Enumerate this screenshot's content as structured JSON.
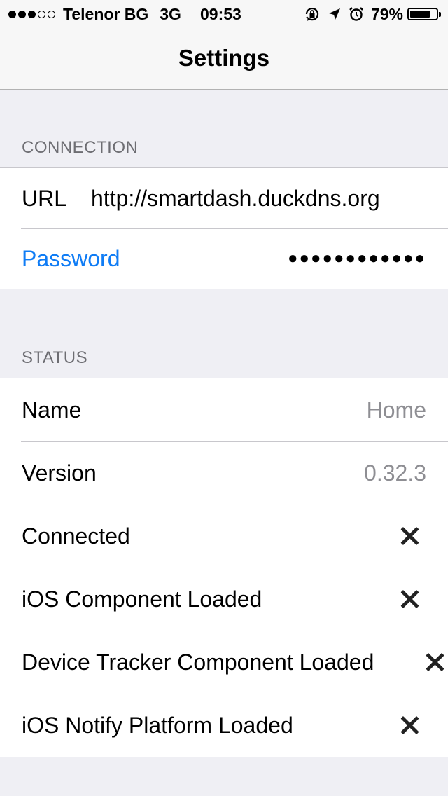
{
  "status_bar": {
    "signal_bars_full": 3,
    "signal_bars_total": 5,
    "carrier": "Telenor BG",
    "network": "3G",
    "time": "09:53",
    "icons": [
      "orientation-lock-icon",
      "location-arrow-icon",
      "alarm-icon"
    ],
    "battery_percent_label": "79%",
    "battery_level": 0.79
  },
  "nav": {
    "title": "Settings"
  },
  "connection": {
    "header": "CONNECTION",
    "url_label": "URL",
    "url_value": "http://smartdash.duckdns.org",
    "password_label": "Password",
    "password_value": "●●●●●●●●●●●●"
  },
  "status": {
    "header": "STATUS",
    "rows": [
      {
        "label": "Name",
        "value": "Home"
      },
      {
        "label": "Version",
        "value": "0.32.3"
      },
      {
        "label": "Connected",
        "value_icon": "x-icon"
      },
      {
        "label": "iOS Component Loaded",
        "value_icon": "x-icon"
      },
      {
        "label": "Device Tracker Component Loaded",
        "value_icon": "x-icon"
      },
      {
        "label": "iOS Notify Platform Loaded",
        "value_icon": "x-icon"
      }
    ]
  },
  "colors": {
    "accent": "#0f7cf5",
    "background": "#efeff4",
    "separator": "#c8c7cc",
    "secondary_text": "#8e8e93",
    "header_text": "#6d6d72"
  }
}
